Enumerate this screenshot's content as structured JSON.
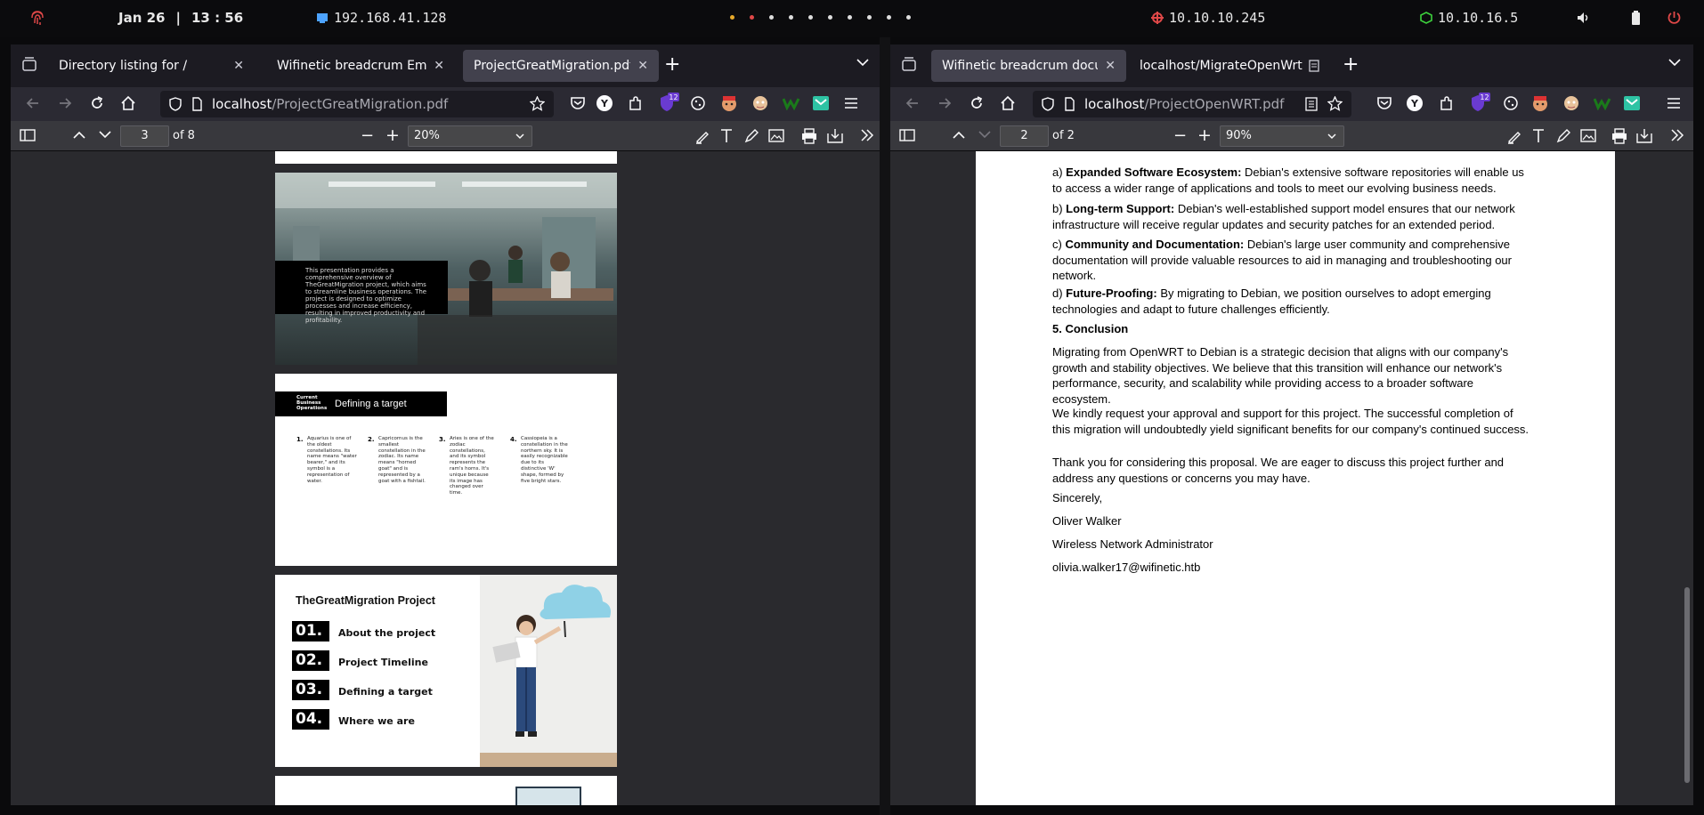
{
  "system_bar": {
    "date": "Jan 26",
    "time": "13 : 56",
    "vm_ip": "192.168.41.128",
    "vpn_ip": "10.10.10.245",
    "target_ip": "10.10.16.5"
  },
  "left_window": {
    "tabs": [
      {
        "title": "Directory listing for /"
      },
      {
        "title": "Wifinetic breadcrum Emplo"
      },
      {
        "title": "ProjectGreatMigration.pdf"
      }
    ],
    "url_host": "localhost",
    "url_path": "/ProjectGreatMigration.pdf",
    "page_number": "3",
    "page_total": "of 8",
    "zoom": "20%",
    "notification_badge": "12",
    "slide2_text": "This presentation provides a comprehensive overview of TheGreatMigration project, which aims to streamline business operations. The project is designed to optimize processes and increase efficiency, resulting in improved productivity and profitability.",
    "slide3": {
      "small_label": "Current Business Operations",
      "title": "Defining a target",
      "columns": [
        {
          "num": "1.",
          "text": "Aquarius is one of the oldest constellations. Its name means \"water bearer,\" and its symbol is a representation of water."
        },
        {
          "num": "2.",
          "text": "Capricornus is the smallest constellation in the zodiac. Its name means \"horned goat\" and is represented by a goat with a fishtail."
        },
        {
          "num": "3.",
          "text": "Aries is one of the zodiac constellations, and its symbol represents the ram's horns. It's unique because its image has changed over time."
        },
        {
          "num": "4.",
          "text": "Cassiopeia is a constellation in the northern sky. It is easily recognizable due to its distinctive 'W' shape, formed by five bright stars."
        }
      ]
    },
    "slide4": {
      "title": "TheGreatMigration Project",
      "items": [
        {
          "num": "01.",
          "label": "About the project"
        },
        {
          "num": "02.",
          "label": "Project Timeline"
        },
        {
          "num": "03.",
          "label": "Defining a target"
        },
        {
          "num": "04.",
          "label": "Where we are"
        }
      ]
    }
  },
  "right_window": {
    "tabs": [
      {
        "title": "Wifinetic breadcrum documen"
      },
      {
        "title": "localhost/MigrateOpenWrt.txt"
      }
    ],
    "url_host": "localhost",
    "url_path": "/ProjectOpenWRT.pdf",
    "page_number": "2",
    "page_total": "of 2",
    "zoom": "90%",
    "notification_badge": "12",
    "doc": {
      "a_prefix": "a) ",
      "a_bold": "Expanded Software Ecosystem:",
      "a_text": " Debian's extensive software repositories will enable us to access a wider range of applications and tools to meet our evolving business needs.",
      "b_prefix": "b) ",
      "b_bold": "Long-term Support:",
      "b_text": " Debian's well-established support model ensures that our network infrastructure will receive regular updates and security patches for an extended period.",
      "c_prefix": "c) ",
      "c_bold": "Community and Documentation:",
      "c_text": " Debian's large user community and comprehensive documentation will provide valuable resources to aid in managing and troubleshooting our network.",
      "d_prefix": "d) ",
      "d_bold": "Future-Proofing:",
      "d_text": " By migrating to Debian, we position ourselves to adopt emerging technologies and adapt to future challenges efficiently.",
      "conclusion_heading": "5. Conclusion",
      "para1": "Migrating from OpenWRT to Debian is a strategic decision that aligns with our company's growth and stability objectives. We believe that this transition will enhance our network's performance, security, and scalability while providing access to a broader software ecosystem.",
      "para2": "We kindly request your approval and support for this project. The successful completion of this migration will undoubtedly yield significant benefits for our company's continued success.",
      "para3": "Thank you for considering this proposal. We are eager to discuss this project further and address any questions or concerns you may have.",
      "closing": "Sincerely,",
      "name": "Oliver Walker",
      "role": "Wireless Network Administrator",
      "email": "olivia.walker17@wifinetic.htb"
    }
  },
  "colors": {
    "accent_red": "#e04848",
    "accent_green": "#3dd13d",
    "dot_orange": "#e8a92a"
  }
}
